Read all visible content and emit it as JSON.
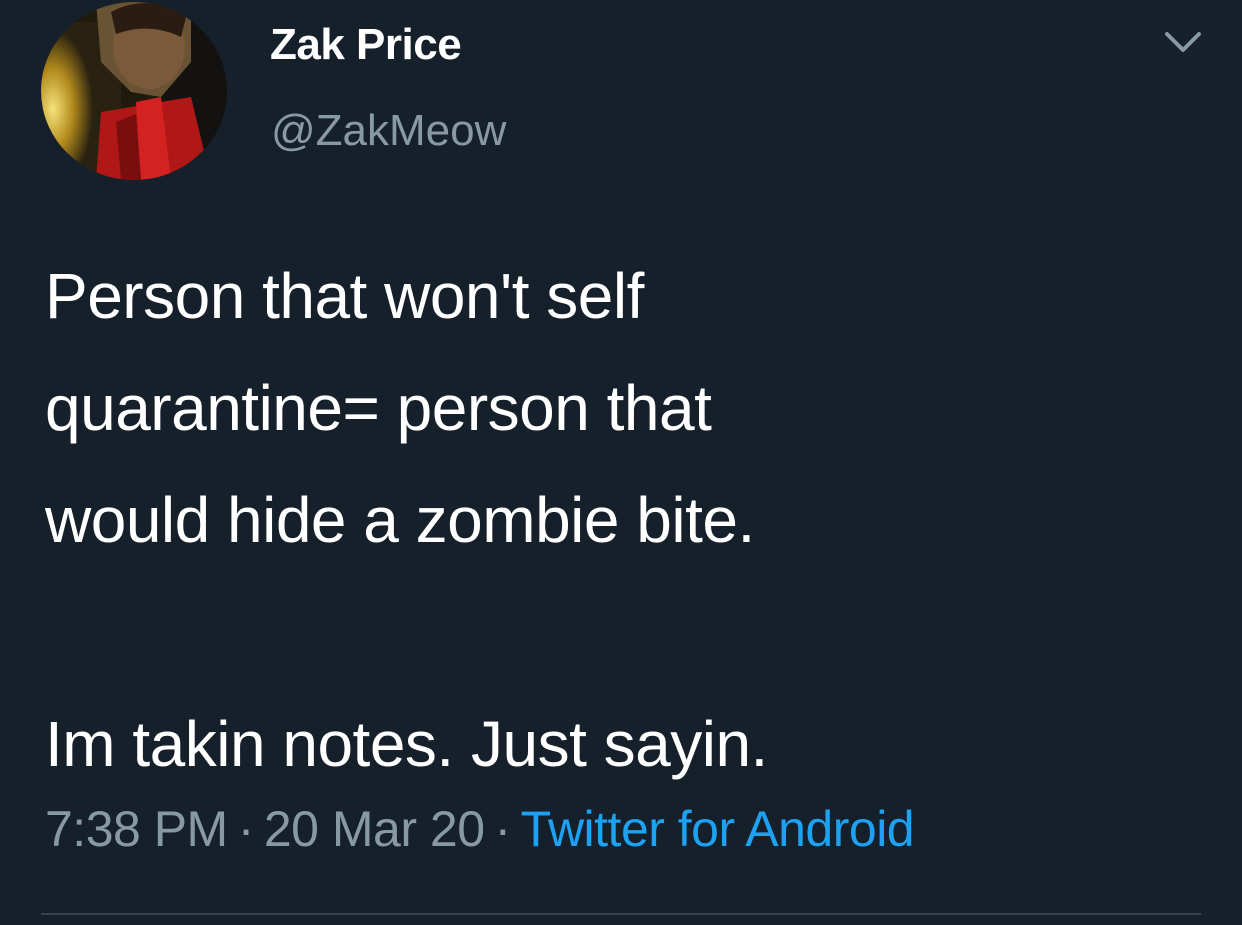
{
  "tweet": {
    "author": {
      "display_name": "Zak Price",
      "handle": "@ZakMeow",
      "avatar": "profile-photo"
    },
    "text_lines": [
      "Person that won't self",
      "quarantine= person that",
      "would hide a zombie bite.",
      "",
      "Im takin notes. Just sayin."
    ],
    "meta": {
      "time": "7:38 PM",
      "separator": "·",
      "date": "20 Mar 20",
      "source": "Twitter for Android"
    },
    "menu_icon": "chevron-down-icon"
  },
  "colors": {
    "background": "#15202b",
    "primary_text": "#ffffff",
    "secondary_text": "#8899a6",
    "link": "#1da1f2",
    "divider": "#38444d"
  }
}
